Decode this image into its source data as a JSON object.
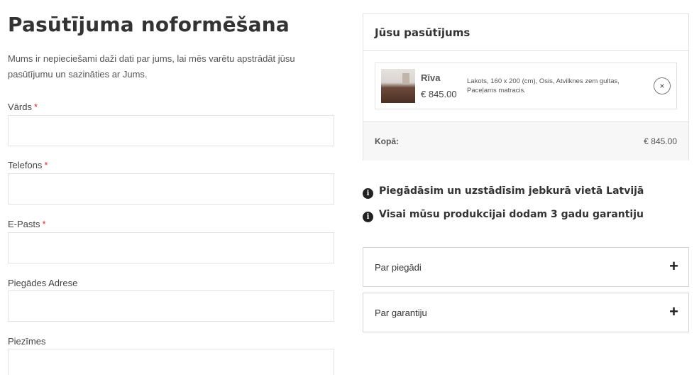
{
  "page": {
    "title": "Pasūtījuma noformēšana",
    "intro": "Mums ir nepieciešami daži dati par jums, lai mēs varētu apstrādāt jūsu pasūtījumu un sazināties ar Jums."
  },
  "form": {
    "name_label": "Vārds",
    "phone_label": "Telefons",
    "email_label": "E-Pasts",
    "address_label": "Piegādes Adrese",
    "notes_label": "Piezīmes",
    "required_mark": "*",
    "name_value": "",
    "phone_value": "",
    "email_value": "",
    "address_value": "",
    "notes_value": ""
  },
  "order": {
    "title": "Jūsu pasūtījums",
    "item": {
      "name": "Rīva",
      "price": "€ 845.00",
      "description": "Lakots, 160 x 200 (cm), Osis, Atvilknes zem gultas, Paceļams matracis.",
      "remove_icon": "×"
    },
    "total_label": "Kopā:",
    "total_value": "€ 845.00"
  },
  "info": {
    "icon": "i",
    "delivery": "Piegādāsim un uzstādīsim jebkurā vietā Latvijā",
    "warranty": "Visai mūsu produkcijai dodam 3 gadu garantiju"
  },
  "accordion": {
    "plus_icon": "+",
    "delivery": "Par piegādi",
    "warranty": "Par garantiju"
  }
}
